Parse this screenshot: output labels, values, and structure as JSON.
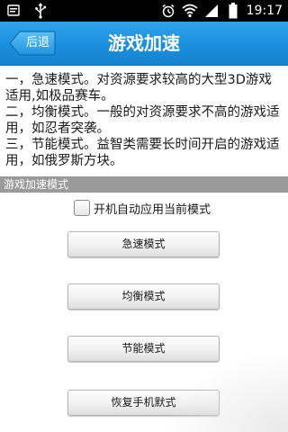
{
  "status_bar": {
    "time": "19:17",
    "icons": [
      "notification-icon",
      "usb-icon",
      "alarm-icon",
      "wifi-icon",
      "signal-icon",
      "battery-icon"
    ]
  },
  "header": {
    "back_label": "后退",
    "title": "游戏加速"
  },
  "description": {
    "lines": [
      "一，急速模式。对资源要求较高的大型3D游戏适用,如极品赛车。",
      "二，均衡模式。一般的对资源要求不高的游戏适用，如忍者突袭。",
      "三，节能模式。益智类需要长时间开启的游戏适用，如俄罗斯方块。"
    ]
  },
  "section": {
    "title": "游戏加速模式"
  },
  "auto_apply": {
    "label": "开机自动应用当前模式",
    "checked": false
  },
  "buttons": {
    "fast": "急速模式",
    "balanced": "均衡模式",
    "power_save": "节能模式",
    "restore": "恢复手机默式"
  },
  "colors": {
    "title_bar": "#1b8fdc",
    "status_bar": "#000000",
    "section_header": "#9a9a9a"
  }
}
